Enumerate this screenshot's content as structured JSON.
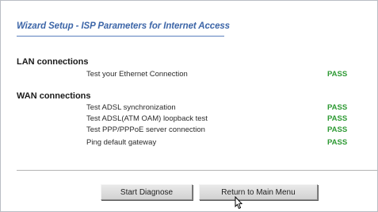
{
  "title": "Wizard Setup - ISP Parameters for Internet Access",
  "lan": {
    "heading": "LAN connections",
    "tests": [
      {
        "label": "Test your Ethernet Connection",
        "status": "PASS"
      }
    ]
  },
  "wan": {
    "heading": "WAN connections",
    "tests": [
      {
        "label": "Test ADSL synchronization",
        "status": "PASS"
      },
      {
        "label": "Test ADSL(ATM OAM) loopback test",
        "status": "PASS"
      },
      {
        "label": "Test PPP/PPPoE server connection",
        "status": "PASS"
      },
      {
        "label": "Ping default gateway",
        "status": "PASS"
      }
    ]
  },
  "buttons": {
    "start_diagnose": "Start Diagnose",
    "return_main_menu": "Return to Main Menu"
  },
  "colors": {
    "title": "#3d66a8",
    "pass": "#2e9a34"
  },
  "icons": {
    "cursor": "mouse-pointer-icon"
  }
}
